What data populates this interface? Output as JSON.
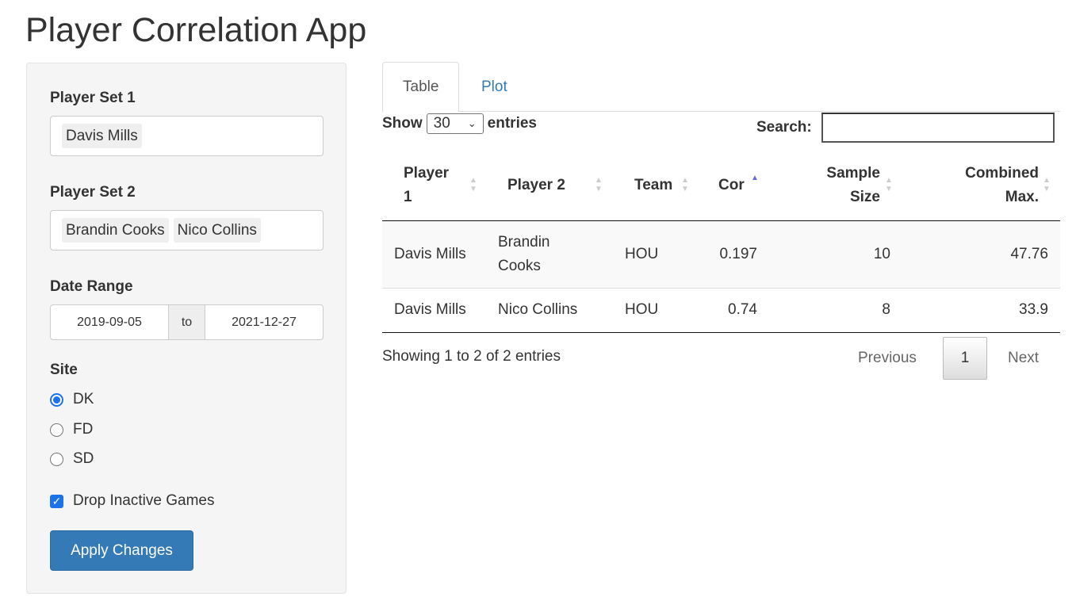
{
  "title": "Player Correlation App",
  "sidebar": {
    "player_set_1": {
      "label": "Player Set 1",
      "selected": [
        "Davis Mills"
      ]
    },
    "player_set_2": {
      "label": "Player Set 2",
      "selected": [
        "Brandin Cooks",
        "Nico Collins"
      ]
    },
    "date_range": {
      "label": "Date Range",
      "start": "2019-09-05",
      "sep": "to",
      "end": "2021-12-27"
    },
    "site": {
      "label": "Site",
      "options": [
        "DK",
        "FD",
        "SD"
      ],
      "selected": "DK"
    },
    "drop_inactive": {
      "label": "Drop Inactive Games",
      "checked": true
    },
    "apply_label": "Apply Changes"
  },
  "tabs": [
    {
      "label": "Table",
      "active": true
    },
    {
      "label": "Plot",
      "active": false
    }
  ],
  "table": {
    "show_label": "Show",
    "length": "30",
    "entries_label": "entries",
    "search_label": "Search:",
    "search_value": "",
    "columns": [
      "Player 1",
      "Player 2",
      "Team",
      "Cor",
      "Sample Size",
      "Combined Max."
    ],
    "sorted_column": "Cor",
    "sort_dir": "ascending",
    "rows": [
      [
        "Davis Mills",
        "Brandin Cooks",
        "HOU",
        "0.197",
        "10",
        "47.76"
      ],
      [
        "Davis Mills",
        "Nico Collins",
        "HOU",
        "0.74",
        "8",
        "33.9"
      ]
    ],
    "info": "Showing 1 to 2 of 2 entries",
    "pagination": {
      "previous": "Previous",
      "current": "1",
      "next": "Next"
    }
  },
  "colors": {
    "primary": "#337ab7",
    "sort_active": "#6b6bd6"
  }
}
